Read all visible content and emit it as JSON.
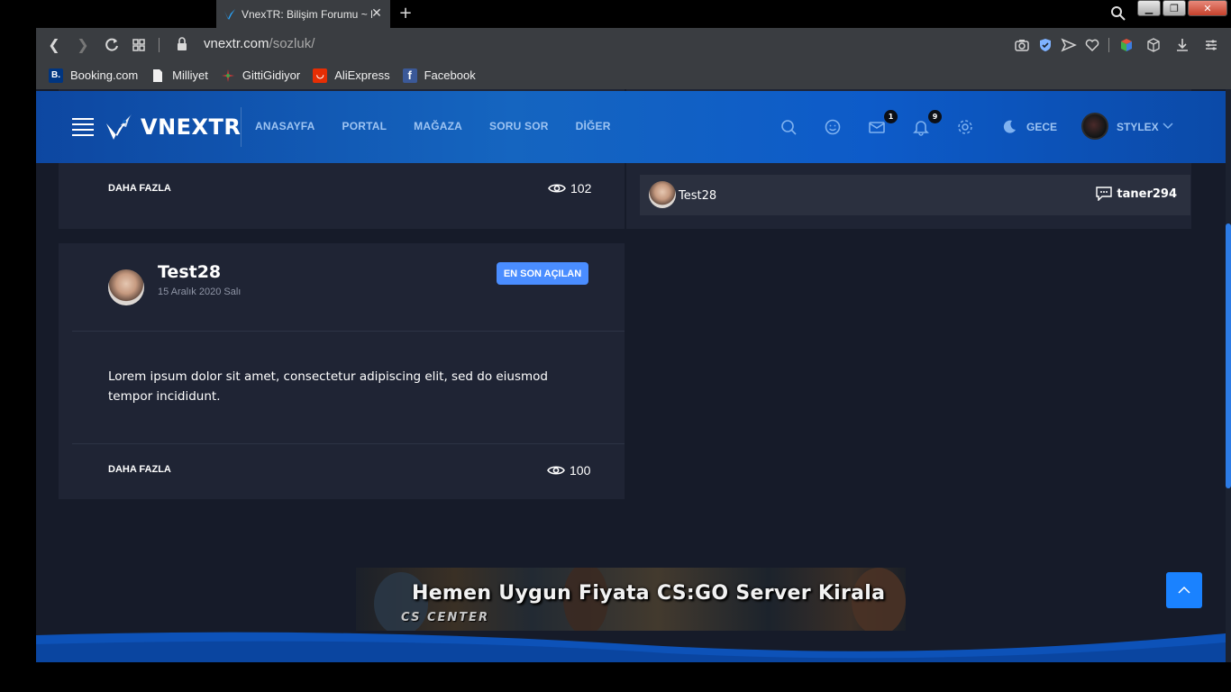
{
  "browser": {
    "tab_title": "VnexTR: Bilişim Forumu ~ B",
    "url_host": "vnextr.com",
    "url_path": "/sozluk/",
    "bookmarks": [
      {
        "label": "Booking.com",
        "icon": "booking-icon",
        "color": "#003580",
        "glyph": "B."
      },
      {
        "label": "Milliyet",
        "icon": "document-icon",
        "color": "#ffffff",
        "glyph": ""
      },
      {
        "label": "GittiGidiyor",
        "icon": "gittigidiyor-icon",
        "color": "#e53935",
        "glyph": ""
      },
      {
        "label": "AliExpress",
        "icon": "aliexpress-icon",
        "color": "#e62e04",
        "glyph": ""
      },
      {
        "label": "Facebook",
        "icon": "facebook-icon",
        "color": "#3b5998",
        "glyph": "f"
      }
    ]
  },
  "header": {
    "logo_text": "VNEXTR",
    "nav": [
      "ANASAYFA",
      "PORTAL",
      "MAĞAZA",
      "SORU SOR",
      "DİĞER"
    ],
    "messages_count": "1",
    "notifications_count": "9",
    "theme_label": "GECE",
    "username": "STYLEX",
    "accent": "#1565c0"
  },
  "top_card": {
    "more_label": "DAHA FAZLA",
    "views": "102"
  },
  "side_list": {
    "item": {
      "name": "Test28",
      "reply_user": "taner294"
    }
  },
  "post": {
    "author": "Test28",
    "date": "15 Aralık 2020 Salı",
    "tag": "EN SON AÇILAN",
    "text": "Lorem ipsum dolor sit amet, consectetur adipiscing elit, sed do eiusmod tempor incididunt.",
    "more_label": "DAHA FAZLA",
    "views": "100"
  },
  "banner": {
    "title": "Hemen Uygun Fiyata CS:GO Server Kirala",
    "sub": "CS CENTER"
  }
}
